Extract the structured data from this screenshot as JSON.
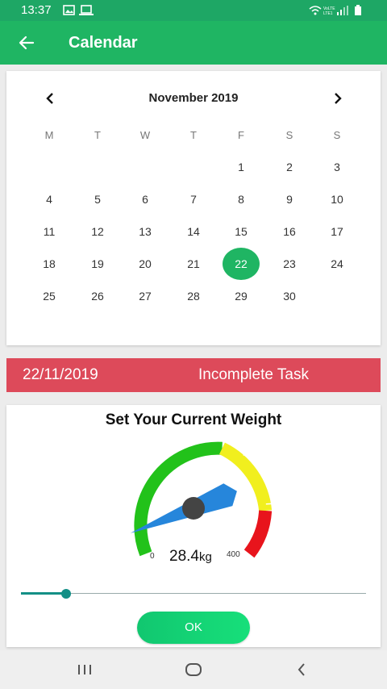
{
  "status_bar": {
    "time": "13:37",
    "left_icons": [
      "image-icon",
      "laptop-icon"
    ],
    "right_icons": [
      "wifi-icon",
      "lte-signal-icon",
      "battery-icon"
    ]
  },
  "app_bar": {
    "title": "Calendar",
    "back_icon": "arrow-left-icon",
    "color": "#1fb563"
  },
  "calendar": {
    "month_label": "November 2019",
    "weekdays": [
      "M",
      "T",
      "W",
      "T",
      "F",
      "S",
      "S"
    ],
    "first_weekday_index": 4,
    "days_in_month": 30,
    "selected_day": 22,
    "days": [
      "1",
      "2",
      "3",
      "4",
      "5",
      "6",
      "7",
      "8",
      "9",
      "10",
      "11",
      "12",
      "13",
      "14",
      "15",
      "16",
      "17",
      "18",
      "19",
      "20",
      "21",
      "22",
      "23",
      "24",
      "25",
      "26",
      "27",
      "28",
      "29",
      "30"
    ],
    "selected_color": "#1fb563"
  },
  "task_banner": {
    "date": "22/11/2019",
    "status": "Incomplete Task",
    "color": "#dd4a5a"
  },
  "weight": {
    "title": "Set Your Current Weight",
    "gauge_min": "0",
    "gauge_max": "400",
    "value": "28.4",
    "unit": "kg",
    "value_fraction": 0.071,
    "slider_fraction": 0.13,
    "ok_label": "OK",
    "zone_colors": [
      "#22c21a",
      "#f1ef1e",
      "#e8141c"
    ],
    "needle_color": "#2686db"
  },
  "nav_bar": {
    "icons": [
      "recent-apps-icon",
      "home-icon",
      "back-icon"
    ]
  }
}
